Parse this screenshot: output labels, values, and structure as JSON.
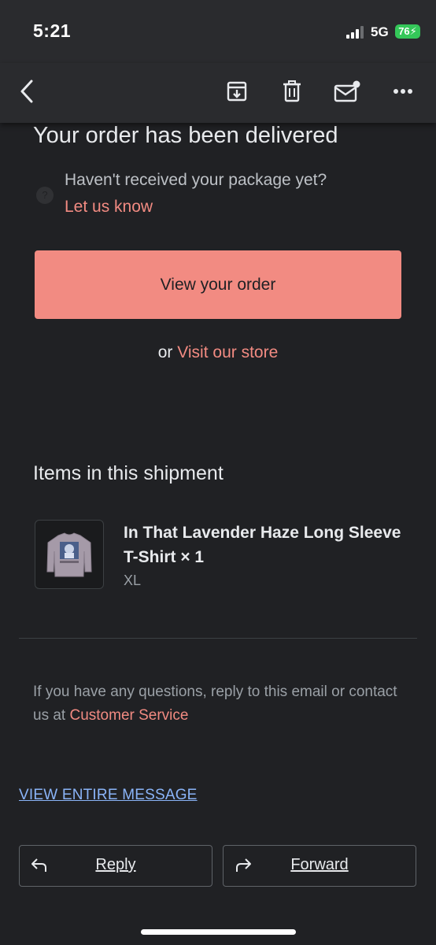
{
  "status_bar": {
    "time": "5:21",
    "network": "5G",
    "battery": "76"
  },
  "toolbar": {
    "icons": [
      "back-icon",
      "archive-icon",
      "delete-icon",
      "mark-unread-icon",
      "more-icon"
    ]
  },
  "email": {
    "headline": "Your order has been delivered",
    "notice_text": "Haven't received your package yet?",
    "notice_link": "Let us know",
    "primary_button": "View your order",
    "store_prefix": "or",
    "store_link": "Visit our store",
    "section_title": "Items in this shipment",
    "item": {
      "name": "In That Lavender Haze Long Sleeve T-Shirt × 1",
      "variant": "XL"
    },
    "questions_text": "If you have any questions, reply to this email or contact us at",
    "questions_link": "Customer Service"
  },
  "footer": {
    "view_entire": "VIEW ENTIRE MESSAGE",
    "reply_label": "Reply",
    "forward_label": "Forward"
  },
  "colors": {
    "background": "#202124",
    "accent": "#f28b82",
    "link_blue": "#8ab4f8",
    "battery": "#34c759"
  }
}
